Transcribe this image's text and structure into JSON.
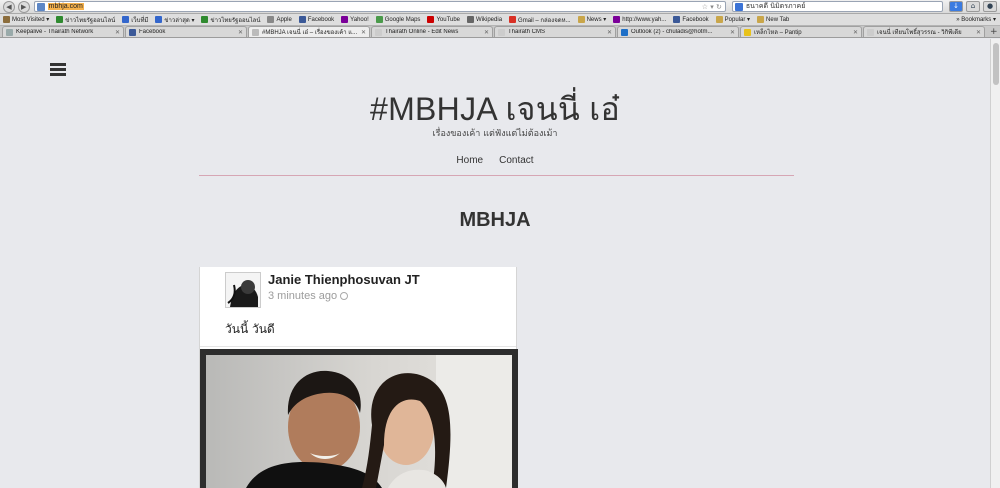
{
  "browser": {
    "url": "mbhja.com",
    "search_text": "ธนาคดี นิมิตรภาคย์",
    "bookmarks": [
      {
        "label": "Most Visited ▾",
        "color": "#8c6d3c"
      },
      {
        "label": "ข่าวไทยรัฐออนไลน์",
        "color": "#2f8a2f"
      },
      {
        "label": "เว็บที่มี",
        "color": "#3366cc"
      },
      {
        "label": "ข่าวล่าสุด ▾",
        "color": "#3366cc"
      },
      {
        "label": "ข่าวไทยรัฐออนไลน์",
        "color": "#2f8a2f"
      },
      {
        "label": "Apple",
        "color": "#888888"
      },
      {
        "label": "Facebook",
        "color": "#3b5998"
      },
      {
        "label": "Yahoo!",
        "color": "#7b0099"
      },
      {
        "label": "Google Maps",
        "color": "#4a9a4a"
      },
      {
        "label": "YouTube",
        "color": "#cc0000"
      },
      {
        "label": "Wikipedia",
        "color": "#666666"
      },
      {
        "label": "Gmail – กล่องจดห...",
        "color": "#d93025"
      },
      {
        "label": "News ▾",
        "color": "#c9a64a"
      },
      {
        "label": "http://www.yah...",
        "color": "#7b0099"
      },
      {
        "label": "Facebook",
        "color": "#3b5998"
      },
      {
        "label": "Popular ▾",
        "color": "#c9a64a"
      },
      {
        "label": "New Tab",
        "color": "#c9a64a"
      }
    ],
    "bookmarks_menu": "» Bookmarks ▾",
    "tabs": [
      {
        "label": "Keepalive - Thairath Network",
        "color": "#9aa",
        "active": false
      },
      {
        "label": "Facebook",
        "color": "#3b5998",
        "active": false
      },
      {
        "label": "#MBHJA เจนนี่ เอ๋ – เรื่องของเค้า แ...",
        "color": "#bbbbbb",
        "active": true
      },
      {
        "label": "Thairath Online - Edit News",
        "color": "#cccccc",
        "active": false
      },
      {
        "label": "Thairath CMS",
        "color": "#cccccc",
        "active": false
      },
      {
        "label": "Outlook (2) - chuladis@hotm...",
        "color": "#1e6fc7",
        "active": false
      },
      {
        "label": "เหล็กไหล – Pantip",
        "color": "#e8c21a",
        "active": false
      },
      {
        "label": "เจนนี่ เทียนโพธิ์สุวรรณ - วิกิพีเดีย",
        "color": "#cccccc",
        "active": false
      }
    ]
  },
  "site": {
    "title": "#MBHJA เจนนี่ เอ๋",
    "description": "เรื่องของเค้า แต่ฟังแต่ไม่ต้องเม้า",
    "nav": [
      "Home",
      "Contact"
    ],
    "heading": "MBHJA"
  },
  "post": {
    "author": "Janie Thienphosuvan JT",
    "time": "3 minutes ago",
    "text": "วันนี้ วันดี"
  }
}
